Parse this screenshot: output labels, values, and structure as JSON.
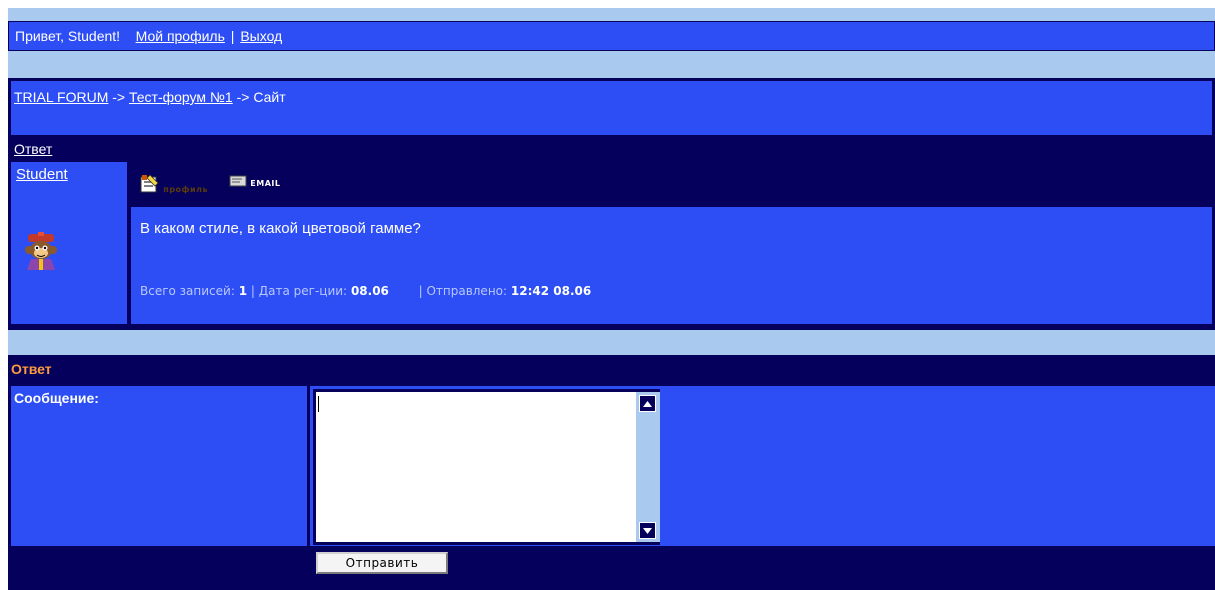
{
  "userbar": {
    "greeting": "Привет, Student!",
    "profile_link": "Мой профиль",
    "separator": "|",
    "logout_link": "Выход"
  },
  "breadcrumb": {
    "forum_link": "TRIAL FORUM",
    "arrow1": "->",
    "subforum_link": "Тест-форум №1",
    "arrow2": "->",
    "topic": "Сайт"
  },
  "reply_link": "Ответ",
  "post": {
    "author": "Student",
    "avatar_icon": "monkey-avatar-icon",
    "profile_button": "профиль",
    "profile_icon": "profile-card-icon",
    "email_button": "EMAIL",
    "email_icon": "envelope-icon",
    "text": "В каком стиле, в какой цветовой гамме?",
    "meta": {
      "posts_label": "Всего записей:",
      "posts_value": "1",
      "reg_label": "Дата рег-ции:",
      "reg_value": "08.06",
      "sent_label": "Отправлено:",
      "sent_value": "12:42 08.06",
      "sep": "|"
    }
  },
  "reply_form": {
    "heading": "Ответ",
    "message_label": "Сообщение:",
    "message_value": "",
    "submit_label": "Отправить"
  },
  "colors": {
    "page_bg": "#a9c9ee",
    "panel_blue": "#2d4ef5",
    "dark_navy": "#05005c",
    "reply_heading": "#ff9a3d"
  }
}
